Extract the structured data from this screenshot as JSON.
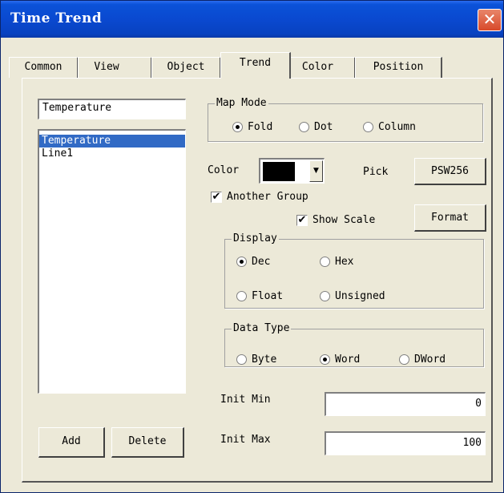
{
  "window": {
    "title": "Time Trend",
    "close_glyph": "✕"
  },
  "tabs": [
    {
      "label": "Common",
      "active": false
    },
    {
      "label": "View",
      "active": false
    },
    {
      "label": "Object",
      "active": false
    },
    {
      "label": "Trend",
      "active": true
    },
    {
      "label": "Color",
      "active": false
    },
    {
      "label": "Position",
      "active": false
    }
  ],
  "name_input": {
    "value": "Temperature"
  },
  "line_list": {
    "items": [
      "Temperature",
      "Line1"
    ],
    "selected_index": 0
  },
  "buttons": {
    "add": "Add",
    "delete": "Delete",
    "pick_value": "PSW256",
    "format": "Format"
  },
  "map_mode": {
    "label": "Map Mode",
    "options": [
      "Fold",
      "Dot",
      "Column"
    ],
    "selected": "Fold"
  },
  "color": {
    "label": "Color",
    "value": "#000000",
    "pick_label": "Pick"
  },
  "another_group": {
    "label": "Another Group",
    "checked": true
  },
  "show_scale": {
    "label": "Show Scale",
    "checked": true
  },
  "display": {
    "label": "Display",
    "options": [
      "Dec",
      "Hex",
      "Float",
      "Unsigned"
    ],
    "selected": "Dec"
  },
  "data_type": {
    "label": "Data Type",
    "options": [
      "Byte",
      "Word",
      "DWord"
    ],
    "selected": "Word"
  },
  "init_min": {
    "label": "Init Min",
    "value": "0"
  },
  "init_max": {
    "label": "Init Max",
    "value": "100"
  },
  "check_glyph": "✔"
}
